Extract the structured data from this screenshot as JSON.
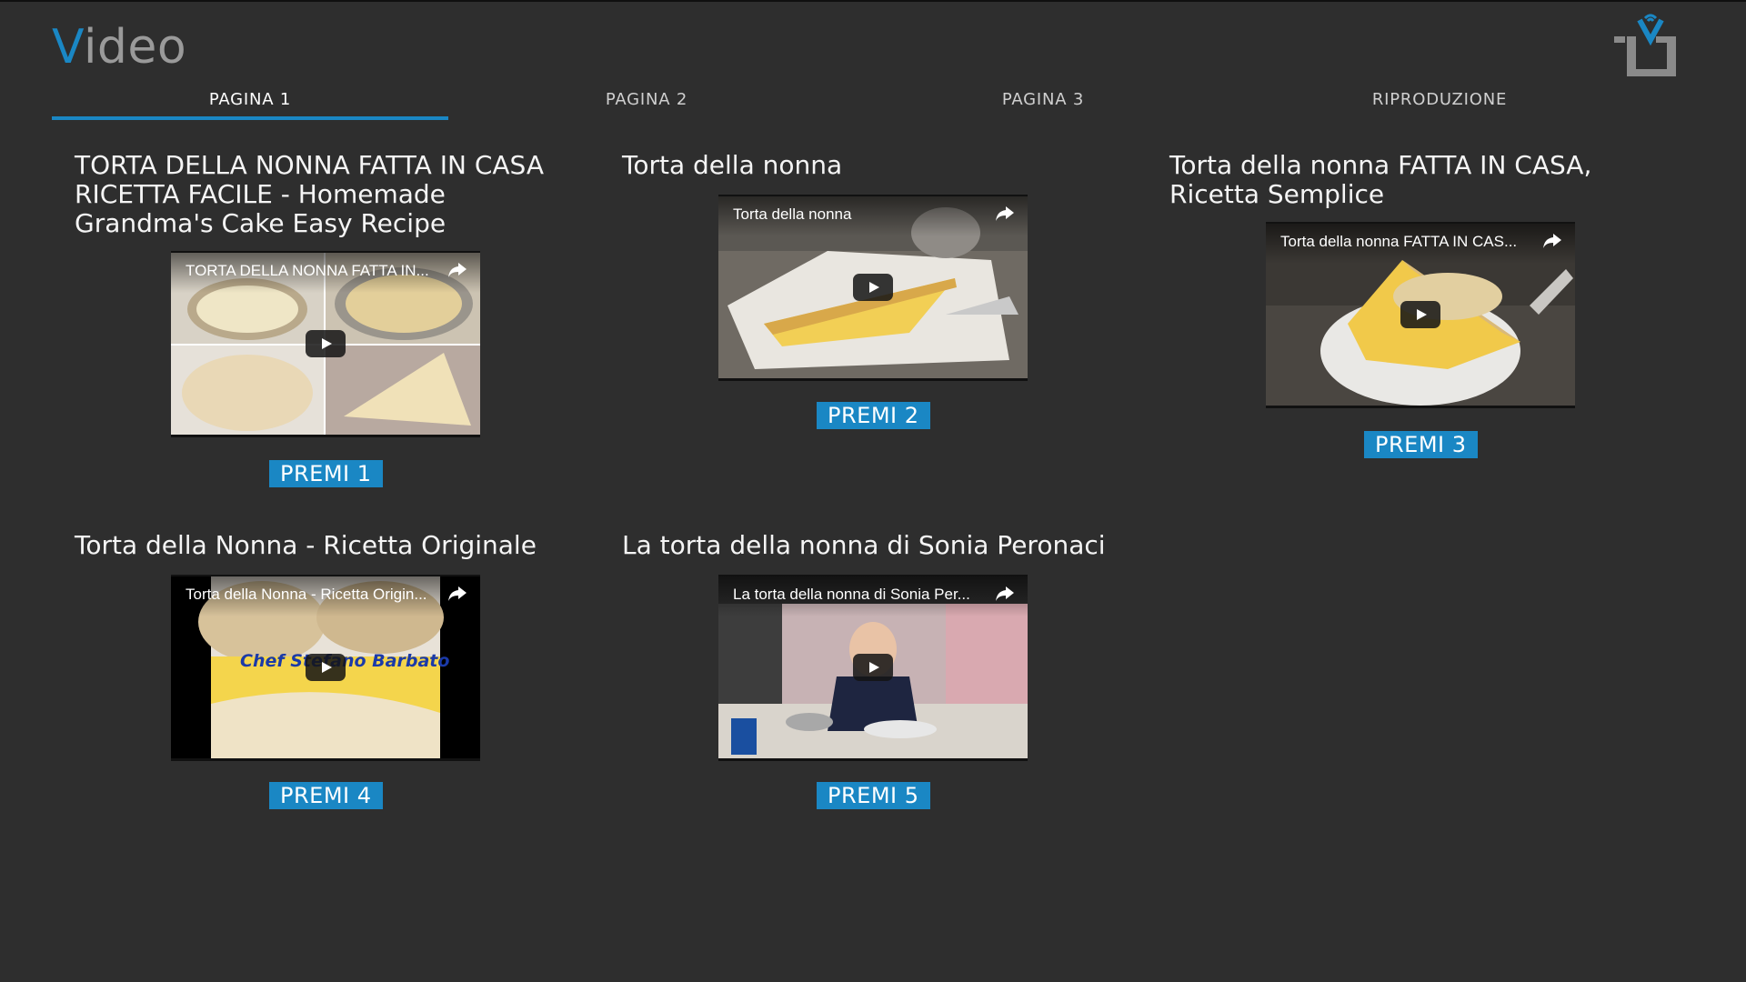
{
  "app": {
    "title_accent": "V",
    "title_rest": "ideo"
  },
  "tabs": [
    {
      "label": "PAGINA 1",
      "active": true
    },
    {
      "label": "PAGINA 2",
      "active": false
    },
    {
      "label": "PAGINA 3",
      "active": false
    },
    {
      "label": "RIPRODUZIONE",
      "active": false
    }
  ],
  "videos": [
    {
      "title": "TORTA DELLA NONNA FATTA IN CASA RICETTA FACILE - Homemade Grandma's Cake Easy Recipe",
      "thumb_title": "TORTA DELLA NONNA FATTA IN...",
      "button": "PREMI 1"
    },
    {
      "title": "Torta della nonna",
      "thumb_title": "Torta della nonna",
      "button": "PREMI 2"
    },
    {
      "title": "Torta della nonna FATTA IN CASA, Ricetta Semplice",
      "thumb_title": "Torta della nonna FATTA IN CAS...",
      "button": "PREMI 3"
    },
    {
      "title": "Torta della Nonna - Ricetta Originale",
      "thumb_title": "Torta della Nonna - Ricetta Origin...",
      "button": "PREMI 4",
      "overlay_text": "Chef Stefano Barbato"
    },
    {
      "title": "La torta della nonna di Sonia Peronaci",
      "thumb_title": "La torta della nonna di Sonia Per...",
      "button": "PREMI 5"
    }
  ],
  "colors": {
    "background": "#2e2e2e",
    "accent": "#1a87c4",
    "text": "#f2f2f2"
  }
}
